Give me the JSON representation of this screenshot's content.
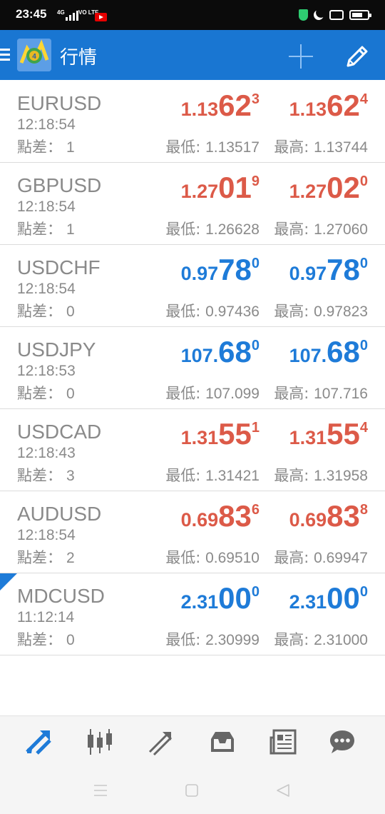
{
  "status_bar": {
    "time": "23:45",
    "network": "4G",
    "volte": "VO LTE"
  },
  "app_bar": {
    "title": "行情",
    "icons": [
      "menu-icon",
      "metatrader-logo",
      "add-icon",
      "edit-icon"
    ]
  },
  "labels": {
    "spread": "點差：",
    "low": "最低: ",
    "high": "最高: "
  },
  "colors": {
    "up": "#dc5a48",
    "down": "#1e7bd8",
    "appbar": "#1976d2",
    "accent": "#1e7bd8"
  },
  "quotes": [
    {
      "symbol": "EURUSD",
      "time": "12:18:54",
      "spread": "1",
      "color": "red",
      "bid": {
        "pre": "1.13",
        "big": "62",
        "sup": "3"
      },
      "ask": {
        "pre": "1.13",
        "big": "62",
        "sup": "4"
      },
      "low": "1.13517",
      "high": "1.13744"
    },
    {
      "symbol": "GBPUSD",
      "time": "12:18:54",
      "spread": "1",
      "color": "red",
      "bid": {
        "pre": "1.27",
        "big": "01",
        "sup": "9"
      },
      "ask": {
        "pre": "1.27",
        "big": "02",
        "sup": "0"
      },
      "low": "1.26628",
      "high": "1.27060"
    },
    {
      "symbol": "USDCHF",
      "time": "12:18:54",
      "spread": "0",
      "color": "blue",
      "bid": {
        "pre": "0.97",
        "big": "78",
        "sup": "0"
      },
      "ask": {
        "pre": "0.97",
        "big": "78",
        "sup": "0"
      },
      "low": "0.97436",
      "high": "0.97823"
    },
    {
      "symbol": "USDJPY",
      "time": "12:18:53",
      "spread": "0",
      "color": "blue",
      "bid": {
        "pre": "107.",
        "big": "68",
        "sup": "0"
      },
      "ask": {
        "pre": "107.",
        "big": "68",
        "sup": "0"
      },
      "low": "107.099",
      "high": "107.716"
    },
    {
      "symbol": "USDCAD",
      "time": "12:18:43",
      "spread": "3",
      "color": "red",
      "bid": {
        "pre": "1.31",
        "big": "55",
        "sup": "1"
      },
      "ask": {
        "pre": "1.31",
        "big": "55",
        "sup": "4"
      },
      "low": "1.31421",
      "high": "1.31958"
    },
    {
      "symbol": "AUDUSD",
      "time": "12:18:54",
      "spread": "2",
      "color": "red",
      "bid": {
        "pre": "0.69",
        "big": "83",
        "sup": "6"
      },
      "ask": {
        "pre": "0.69",
        "big": "83",
        "sup": "8"
      },
      "low": "0.69510",
      "high": "0.69947"
    },
    {
      "symbol": "MDCUSD",
      "time": "11:12:14",
      "spread": "0",
      "color": "blue",
      "bid": {
        "pre": "2.31",
        "big": "00",
        "sup": "0"
      },
      "ask": {
        "pre": "2.31",
        "big": "00",
        "sup": "0"
      },
      "low": "2.30999",
      "high": "2.31000",
      "selected": true
    }
  ],
  "bottom_nav": {
    "tabs": [
      "quotes-icon",
      "chart-icon",
      "trade-icon",
      "history-icon",
      "news-icon",
      "messages-icon"
    ],
    "active": "quotes-icon"
  },
  "system_nav": {
    "buttons": [
      "recents-icon",
      "home-icon",
      "back-icon"
    ]
  }
}
